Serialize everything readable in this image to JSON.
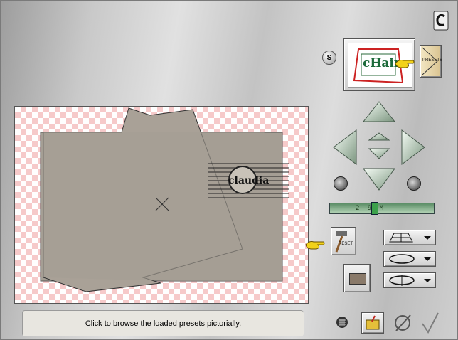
{
  "toolbar": {
    "logo_letter": "C",
    "shuffle_letter": "S",
    "preset_thumb_text": "cHair",
    "presets_label": "PRESETS",
    "reset_label": "RESET"
  },
  "slider": {
    "ticks": "2  9  M"
  },
  "status": {
    "message": "Click to browse the loaded presets pictorially."
  },
  "watermark": {
    "text": "claudia"
  },
  "colors": {
    "checker": "#f6caca",
    "paper": "#a59e94",
    "arrow": "#9fb5a2",
    "pointer": "#f2d21a"
  },
  "icons": {
    "logo": "logo-c-icon",
    "pointer": "hand-pointer-icon",
    "reset": "hammer-icon",
    "grid": "grid-icon",
    "folder": "folder-icon",
    "cancel": "cancel-icon",
    "ok": "checkmark-icon"
  }
}
